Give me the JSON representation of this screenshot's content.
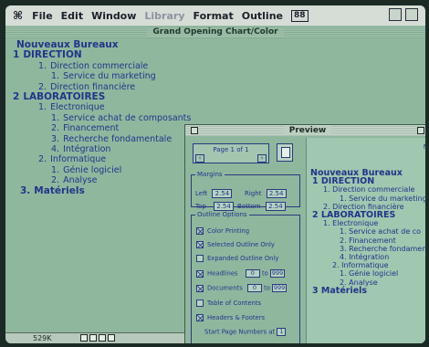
{
  "menubar": {
    "apple": "⌘",
    "items": [
      {
        "label": "File",
        "enabled": true
      },
      {
        "label": "Edit",
        "enabled": true
      },
      {
        "label": "Window",
        "enabled": true
      },
      {
        "label": "Library",
        "enabled": false
      },
      {
        "label": "Format",
        "enabled": true
      },
      {
        "label": "Outline",
        "enabled": true
      }
    ],
    "box_label": "88"
  },
  "main_window": {
    "title": "Grand Opening Chart/Color",
    "outline": [
      {
        "num": "",
        "text": "Nouveaux Bureaux",
        "level": "title"
      },
      {
        "num": "1",
        "text": "DIRECTION",
        "level": "0"
      },
      {
        "num": "1.",
        "text": "Direction commerciale",
        "level": "1"
      },
      {
        "num": "1.",
        "text": "Service du marketing",
        "level": "2"
      },
      {
        "num": "2.",
        "text": "Direction financière",
        "level": "1"
      },
      {
        "num": "2",
        "text": "LABORATOIRES",
        "level": "0"
      },
      {
        "num": "1.",
        "text": "Electronique",
        "level": "1"
      },
      {
        "num": "1.",
        "text": "Service achat de composants",
        "level": "2"
      },
      {
        "num": "2.",
        "text": "Financement",
        "level": "2"
      },
      {
        "num": "3.",
        "text": "Recherche fondamentale",
        "level": "2"
      },
      {
        "num": "4.",
        "text": "Intégration",
        "level": "2"
      },
      {
        "num": "2.",
        "text": "Informatique",
        "level": "1"
      },
      {
        "num": "1.",
        "text": "Génie logiciel",
        "level": "2"
      },
      {
        "num": "2.",
        "text": "Analyse",
        "level": "2"
      },
      {
        "num": "3.",
        "text": "Matériels",
        "level": "main"
      }
    ],
    "memory": "529K"
  },
  "preview": {
    "title": "Preview",
    "page_label": "Page 1 of 1",
    "margins_legend": "Margins",
    "margins": {
      "left_label": "Left",
      "left": "2.54",
      "right_label": "Right",
      "right": "2.54",
      "top_label": "Top",
      "top": "2.54",
      "bottom_label": "Bottom",
      "bottom": "2.54"
    },
    "outline_options_legend": "Outline Options",
    "options": [
      {
        "label": "Color Printing",
        "checked": true
      },
      {
        "label": "Selected Outline Only",
        "checked": true
      },
      {
        "label": "Expanded Outline Only",
        "checked": false
      }
    ],
    "headlines": {
      "label": "Headlines",
      "from": "0",
      "to_label": "to",
      "to": "999",
      "checked": true
    },
    "documents": {
      "label": "Documents",
      "from": "0",
      "to_label": "to",
      "to": "999",
      "checked": true
    },
    "table_of_contents": {
      "label": "Table of Contents",
      "checked": false
    },
    "headers_footers": {
      "label": "Headers & Footers",
      "checked": true
    },
    "start_page": {
      "label": "Start Page Numbers at",
      "value": "1"
    },
    "ruler_mark": "N",
    "page_outline": [
      {
        "text": "Nouveaux Bureaux",
        "cls": "title"
      },
      {
        "text": "1  DIRECTION",
        "cls": "h1"
      },
      {
        "text": "1. Direction commerciale",
        "cls": "l1"
      },
      {
        "text": "1. Service du marketing",
        "cls": "l3"
      },
      {
        "text": "2. Direction financière",
        "cls": "l1"
      },
      {
        "text": "2  LABORATOIRES",
        "cls": "h1"
      },
      {
        "text": "1. Electronique",
        "cls": "l1"
      },
      {
        "text": "1. Service achat de co",
        "cls": "l3"
      },
      {
        "text": "2. Financement",
        "cls": "l3"
      },
      {
        "text": "3. Recherche fondamen",
        "cls": "l3"
      },
      {
        "text": "4. Intégration",
        "cls": "l3"
      },
      {
        "text": "2. Informatique",
        "cls": "l2"
      },
      {
        "text": "1. Génie logiciel",
        "cls": "l3"
      },
      {
        "text": "2. Analyse",
        "cls": "l3"
      },
      {
        "text": "3  Matériels",
        "cls": "h1"
      }
    ]
  }
}
